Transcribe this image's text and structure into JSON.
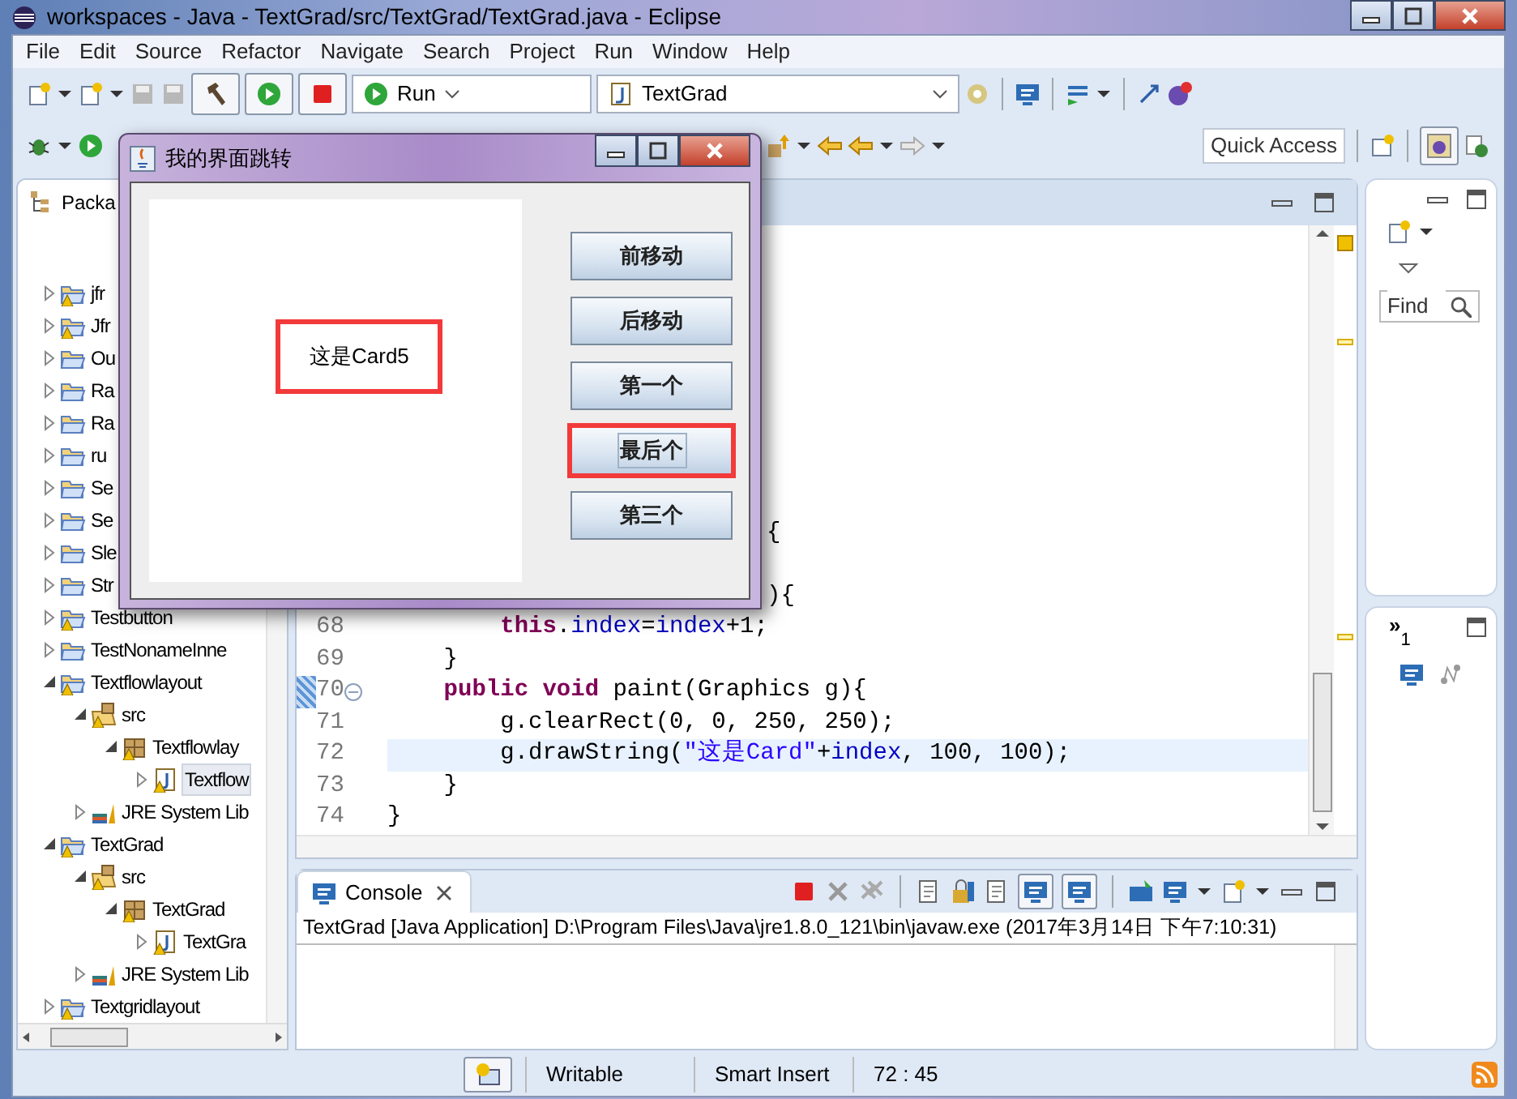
{
  "window": {
    "title": "workspaces - Java - TextGrad/src/TextGrad/TextGrad.java - Eclipse"
  },
  "menu": [
    "File",
    "Edit",
    "Source",
    "Refactor",
    "Navigate",
    "Search",
    "Project",
    "Run",
    "Window",
    "Help"
  ],
  "toolbar": {
    "run_combo": "Run",
    "config_combo": "TextGrad",
    "quick_access": "Quick Access"
  },
  "package_explorer": {
    "title": "Packa",
    "items": [
      {
        "label": "jfr",
        "kind": "project",
        "warning": true,
        "expanded": false
      },
      {
        "label": "Jfr",
        "kind": "project",
        "warning": true,
        "expanded": false
      },
      {
        "label": "Ou",
        "kind": "project",
        "warning": false,
        "expanded": false
      },
      {
        "label": "Ra",
        "kind": "project",
        "warning": false,
        "expanded": false
      },
      {
        "label": "Ra",
        "kind": "project",
        "warning": false,
        "expanded": false
      },
      {
        "label": "ru",
        "kind": "project",
        "warning": false,
        "expanded": false
      },
      {
        "label": "Se",
        "kind": "project",
        "warning": false,
        "expanded": false
      },
      {
        "label": "Se",
        "kind": "project",
        "warning": false,
        "expanded": false
      },
      {
        "label": "Sle",
        "kind": "project",
        "warning": false,
        "expanded": false
      },
      {
        "label": "Str",
        "kind": "project",
        "warning": false,
        "expanded": false
      },
      {
        "label": "Testbutton",
        "kind": "project",
        "warning": true,
        "expanded": false
      },
      {
        "label": "TestNonameInne",
        "kind": "project",
        "warning": false,
        "expanded": false
      },
      {
        "label": "Textflowlayout",
        "kind": "project",
        "warning": true,
        "expanded": true,
        "children": [
          {
            "label": "src",
            "kind": "src",
            "warning": true,
            "expanded": true,
            "children": [
              {
                "label": "Textflowlay",
                "kind": "package",
                "warning": true,
                "expanded": true,
                "children": [
                  {
                    "label": "Textflow",
                    "kind": "java",
                    "warning": true,
                    "expanded": false,
                    "selected": true
                  }
                ]
              }
            ]
          },
          {
            "label": "JRE System Lib",
            "kind": "library",
            "warning": false,
            "expanded": false
          }
        ]
      },
      {
        "label": "TextGrad",
        "kind": "project",
        "warning": true,
        "expanded": true,
        "children": [
          {
            "label": "src",
            "kind": "src",
            "warning": true,
            "expanded": true,
            "children": [
              {
                "label": "TextGrad",
                "kind": "package",
                "warning": true,
                "expanded": true,
                "children": [
                  {
                    "label": "TextGra",
                    "kind": "java",
                    "warning": true,
                    "expanded": false,
                    "selected": false
                  }
                ]
              }
            ]
          },
          {
            "label": "JRE System Lib",
            "kind": "library",
            "warning": false,
            "expanded": false
          }
        ]
      },
      {
        "label": "Textgridlayout",
        "kind": "project",
        "warning": true,
        "expanded": false
      }
    ]
  },
  "editor": {
    "lines": [
      {
        "kind": "fragment",
        "segments": [
          {
            "kind": "plain",
            "text": "{"
          }
        ]
      },
      {
        "kind": "fragment",
        "segments": [
          {
            "kind": "plain",
            "text": "){"
          }
        ]
      },
      {
        "kind": "code",
        "number": "68",
        "current": false,
        "override": false,
        "segments": [
          {
            "kind": "keyword",
            "text": "        this"
          },
          {
            "kind": "plain",
            "text": "."
          },
          {
            "kind": "field",
            "text": "index"
          },
          {
            "kind": "plain",
            "text": "="
          },
          {
            "kind": "field",
            "text": "index"
          },
          {
            "kind": "plain",
            "text": "+1;"
          }
        ]
      },
      {
        "kind": "code",
        "number": "69",
        "current": false,
        "override": false,
        "segments": [
          {
            "kind": "plain",
            "text": "    }"
          }
        ]
      },
      {
        "kind": "code",
        "number": "70",
        "current": false,
        "override": true,
        "segments": [
          {
            "kind": "keyword",
            "text": "    public"
          },
          {
            "kind": "keyword",
            "text": " void"
          },
          {
            "kind": "plain",
            "text": " paint(Graphics g){"
          }
        ]
      },
      {
        "kind": "code",
        "number": "71",
        "current": false,
        "override": false,
        "segments": [
          {
            "kind": "plain",
            "text": "        g.clearRect(0, 0, 250, 250);"
          }
        ]
      },
      {
        "kind": "code",
        "number": "72",
        "current": true,
        "override": false,
        "segments": [
          {
            "kind": "plain",
            "text": "        g.drawString("
          },
          {
            "kind": "string",
            "text": "\"这是Card\""
          },
          {
            "kind": "plain",
            "text": "+"
          },
          {
            "kind": "field",
            "text": "index"
          },
          {
            "kind": "plain",
            "text": ", 100, 100);"
          }
        ]
      },
      {
        "kind": "code",
        "number": "73",
        "current": false,
        "override": false,
        "segments": [
          {
            "kind": "plain",
            "text": "    }"
          }
        ]
      },
      {
        "kind": "code",
        "number": "74",
        "current": false,
        "override": false,
        "segments": [
          {
            "kind": "plain",
            "text": "}"
          }
        ]
      }
    ]
  },
  "console": {
    "title": "Console",
    "output": "TextGrad [Java Application] D:\\Program Files\\Java\\jre1.8.0_121\\bin\\javaw.exe (2017年3月14日 下午7:10:31)"
  },
  "side_panel": {
    "find_placeholder": "Find",
    "overflow": "»",
    "overflow_count": "1"
  },
  "status_bar": [
    "Writable",
    "Smart Insert",
    "72 : 45"
  ],
  "dialog": {
    "title": "我的界面跳转",
    "card_text": "这是Card5",
    "card_highlighted": true,
    "buttons": [
      {
        "label": "前移动",
        "focused": false,
        "highlighted": false
      },
      {
        "label": "后移动",
        "focused": false,
        "highlighted": false
      },
      {
        "label": "第一个",
        "focused": false,
        "highlighted": false
      },
      {
        "label": "最后个",
        "focused": true,
        "highlighted": true
      },
      {
        "label": "第三个",
        "focused": false,
        "highlighted": false
      }
    ]
  }
}
